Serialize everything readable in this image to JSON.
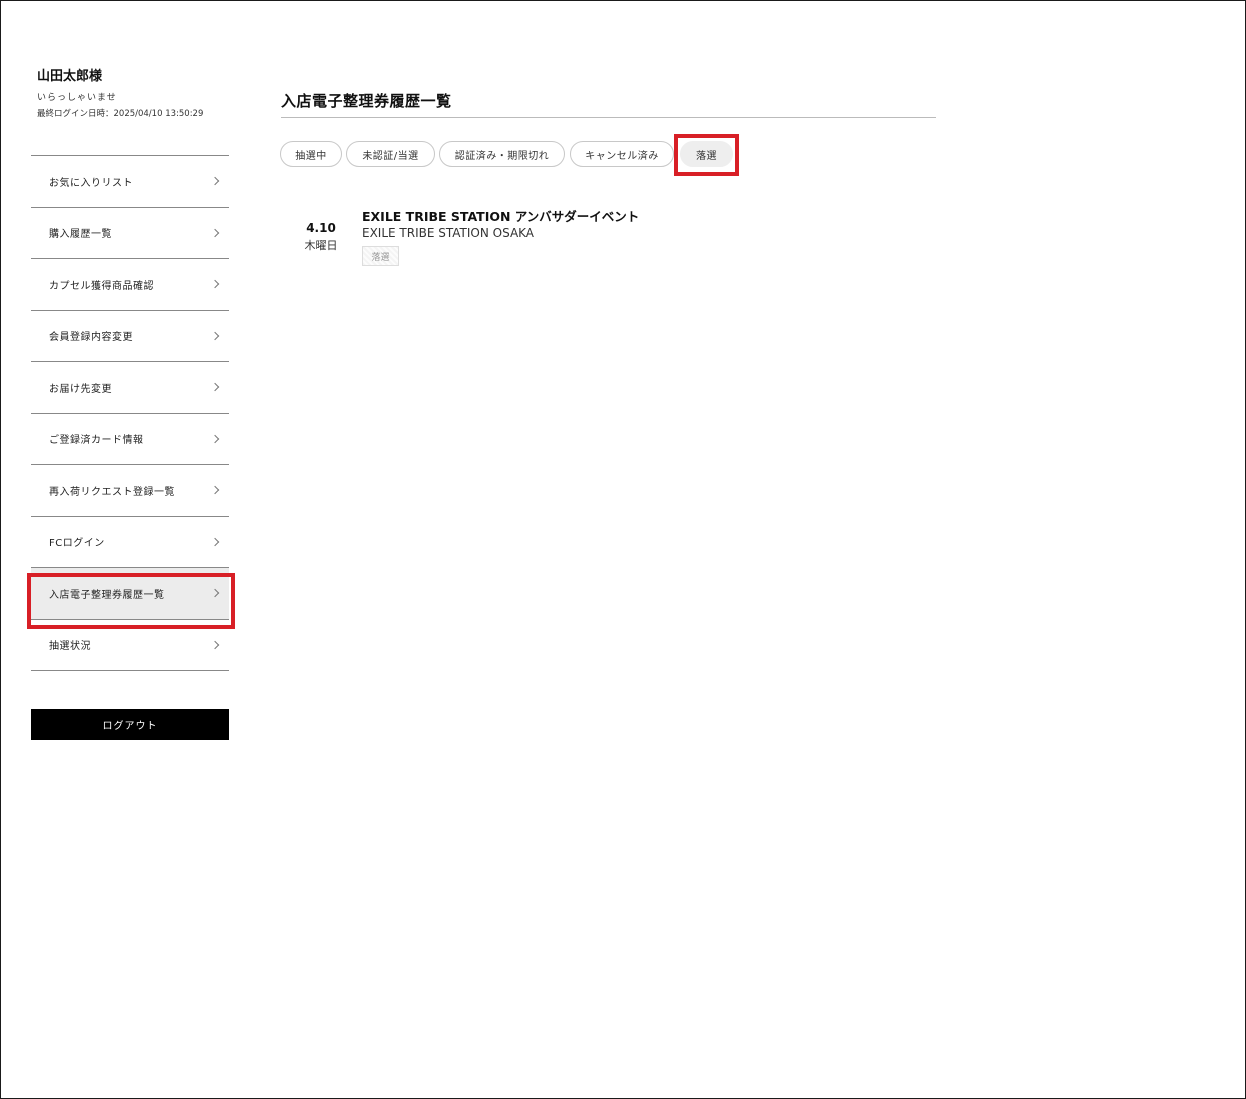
{
  "user": {
    "name": "山田太郎様",
    "greeting": "いらっしゃいませ",
    "last_login": "最終ログイン日時：2025/04/10 13:50:29"
  },
  "menu": [
    {
      "label": "お気に入りリスト"
    },
    {
      "label": "購入履歴一覧"
    },
    {
      "label": "カプセル獲得商品確認"
    },
    {
      "label": "会員登録内容変更"
    },
    {
      "label": "お届け先変更"
    },
    {
      "label": "ご登録済カード情報"
    },
    {
      "label": "再入荷リクエスト登録一覧"
    },
    {
      "label": "FCログイン"
    },
    {
      "label": "入店電子整理券履歴一覧",
      "active": true
    },
    {
      "label": "抽選状況"
    }
  ],
  "logout_label": "ログアウト",
  "page_title": "入店電子整理券履歴一覧",
  "filters": [
    {
      "label": "抽選中"
    },
    {
      "label": "未認証/当選"
    },
    {
      "label": "認証済み・期限切れ"
    },
    {
      "label": "キャンセル済み"
    },
    {
      "label": "落選",
      "selected": true
    }
  ],
  "events": [
    {
      "date": "4.10",
      "weekday": "木曜日",
      "title": "EXILE TRIBE STATION アンバサダーイベント",
      "venue": "EXILE TRIBE STATION OSAKA",
      "status": "落選"
    }
  ],
  "colors": {
    "highlight": "#d81f26",
    "logout_bg": "#000000",
    "active_item_bg": "#ececec"
  }
}
